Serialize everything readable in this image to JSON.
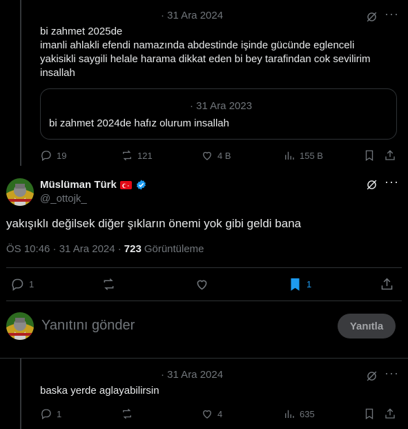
{
  "reply1": {
    "date": "· 31 Ara 2024",
    "lines": [
      "bi zahmet 2025de",
      "imanli ahlakli efendi namazında abdestinde işinde gücünde eglenceli",
      "yakisikli saygili helale harama dikkat eden bi bey tarafindan cok sevilirim",
      "insallah"
    ],
    "quote": {
      "date": "· 31 Ara 2023",
      "text": "bi zahmet 2024de hafız olurum insallah"
    },
    "stats": {
      "replies": "19",
      "reposts": "121",
      "likes": "4 B",
      "views": "155 B"
    }
  },
  "main": {
    "name": "Müslüman Türk",
    "flag": "🇹🇷",
    "handle": "@_ottojk_",
    "text": "yakışıklı değilsek diğer şıkların önemi yok gibi geldi bana",
    "time": "ÖS 10:46 · 31 Ara 2024 ·",
    "views_count": "723",
    "views_label": "Görüntüleme",
    "stats": {
      "replies": "1",
      "bookmarks": "1"
    }
  },
  "composer": {
    "placeholder": "Yanıtını gönder",
    "button": "Yanıtla"
  },
  "reply2": {
    "date": "· 31 Ara 2024",
    "text": "baska yerde aglayabilirsin",
    "stats": {
      "replies": "1",
      "likes": "4",
      "views": "635"
    }
  },
  "colors": {
    "accent": "#1d9bf0",
    "muted": "#71767b",
    "border": "#2f3336"
  }
}
